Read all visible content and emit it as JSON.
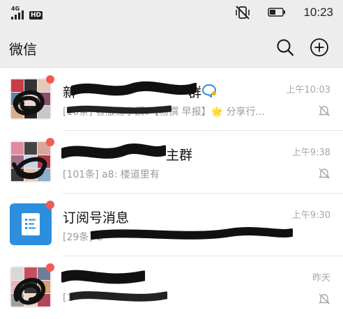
{
  "status_bar": {
    "network": "4G",
    "hd": "HD",
    "time": "10:23"
  },
  "header": {
    "title": "微信",
    "icons": [
      "search-icon",
      "add-icon"
    ]
  },
  "chats": [
    {
      "name": "新",
      "name_end": "群",
      "time": "上午10:03",
      "preview": "[10条] 客服易小撰：【易撰 早报】🌟 分享行...",
      "muted": true,
      "unread_dot": true,
      "avatar": "group"
    },
    {
      "name": "",
      "name_end": "主群",
      "time": "上午9:38",
      "preview": "[101条] a8: 楼道里有",
      "muted": true,
      "unread_dot": true,
      "avatar": "group"
    },
    {
      "name": "订阅号消息",
      "time": "上午9:30",
      "preview": "[29条] C",
      "muted": false,
      "unread_dot": true,
      "avatar": "subscription"
    },
    {
      "name": "",
      "time": "昨天",
      "preview": "[1",
      "muted": true,
      "unread_dot": true,
      "avatar": "group"
    }
  ],
  "colors": {
    "header_bg": "#ededed",
    "unread_dot": "#f25a54",
    "subscription_avatar": "#2e8ede"
  }
}
